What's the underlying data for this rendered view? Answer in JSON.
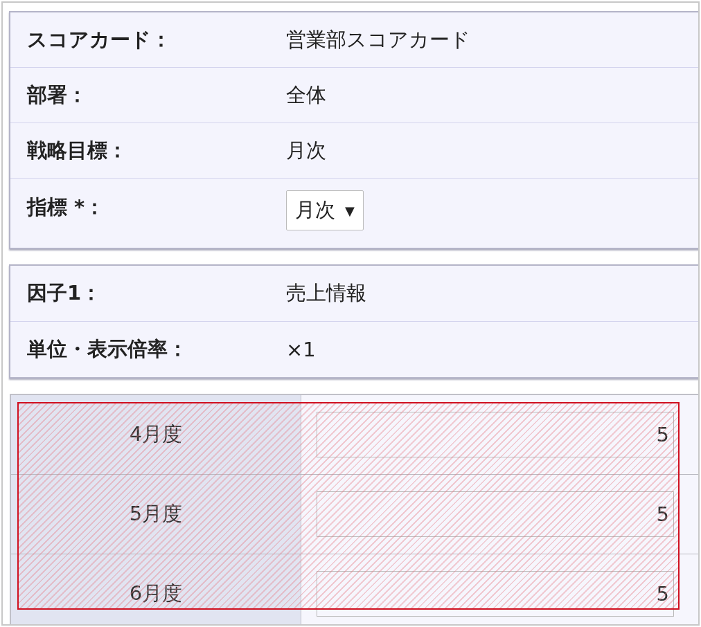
{
  "scorecard_fields": [
    {
      "label": "スコアカード：",
      "kind": "text",
      "value": "営業部スコアカード"
    },
    {
      "label": "部署：",
      "kind": "text",
      "value": "全体"
    },
    {
      "label": "戦略目標：",
      "kind": "text",
      "value": "月次"
    },
    {
      "label": "指標 *：",
      "kind": "select",
      "value": "月次",
      "arrow": "▼"
    }
  ],
  "factor_fields": [
    {
      "label": "因子1：",
      "value": "売上情報"
    },
    {
      "label": "単位・表示倍率：",
      "value": "×1"
    }
  ],
  "monthly_rows": [
    {
      "month": "4月度",
      "value": "5"
    },
    {
      "month": "5月度",
      "value": "5"
    },
    {
      "month": "6月度",
      "value": "5"
    }
  ],
  "highlight": {
    "on": true
  }
}
